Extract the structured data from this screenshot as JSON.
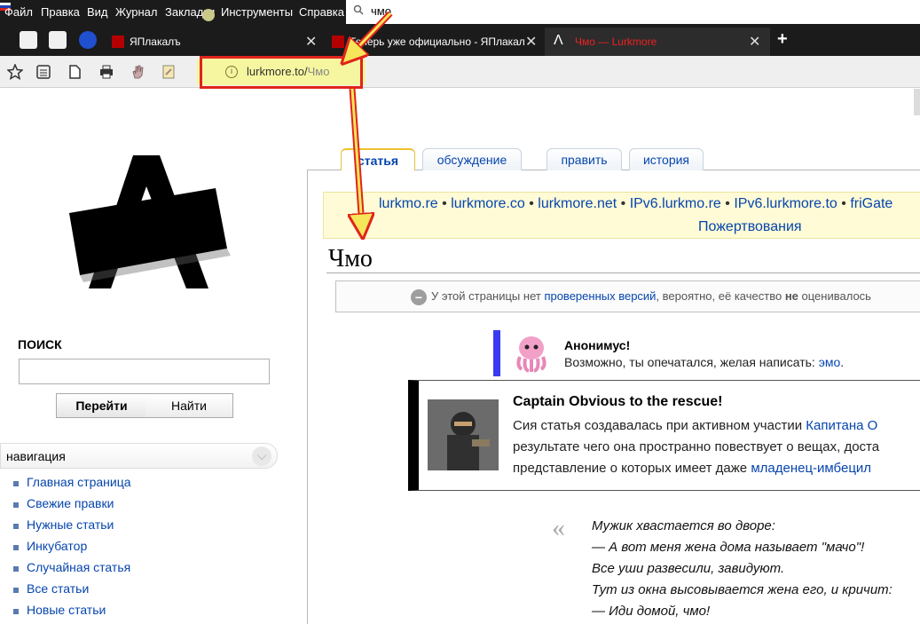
{
  "menubar": {
    "items": [
      "Файл",
      "Правка",
      "Вид",
      "Журнал",
      "Закладки",
      "Инструменты",
      "Справка"
    ],
    "search_text": "чмо"
  },
  "tabs": [
    {
      "title": "ЯПлакалъ"
    },
    {
      "title": "Теперь уже официально - ЯПлакалъ"
    },
    {
      "title": "Чмо — Lurkmore"
    }
  ],
  "toolbar": {
    "url_host": "lurkmore.to/",
    "url_path": "Чмо"
  },
  "sidebar": {
    "search_label": "ПОИСК",
    "go_label": "Перейти",
    "find_label": "Найти",
    "nav_heading": "навигация",
    "nav_items": [
      "Главная страница",
      "Свежие правки",
      "Нужные статьи",
      "Инкубатор",
      "Случайная статья",
      "Все статьи",
      "Новые статьи"
    ]
  },
  "content_tabs": {
    "article": "статья",
    "discussion": "обсуждение",
    "edit": "править",
    "history": "история"
  },
  "mirrors": {
    "items": [
      "lurkmo.re",
      "lurkmore.co",
      "lurkmore.net",
      "IPv6.lurkmo.re",
      "IPv6.lurkmore.to",
      "friGate"
    ],
    "donations": "Пожертвования"
  },
  "page_title": "Чмо",
  "flagged_notice": {
    "text_before": "У этой страницы нет ",
    "link": "проверенных версий",
    "text_mid": ", вероятно, её качество ",
    "bold": "не",
    "text_after": " оценивалось"
  },
  "anon_box": {
    "title": "Анонимус!",
    "text": "Возможно, ты опечатался, желая написать: ",
    "link": "эмо",
    "end": "."
  },
  "captain_box": {
    "title": "Captain Obvious to the rescue!",
    "line1_text": "Сия статья создавалась при активном участии ",
    "line1_link": "Капитана О",
    "line2": "результате чего она пространно повествует о вещах, доста",
    "line3_text": "представление о которых имеет даже ",
    "line3_link": "младенец-имбецил"
  },
  "quote_lines": [
    "Мужик хвастается во дворе:",
    "— А вот меня жена дома называет \"мачо\"!",
    "Все уши развесили, завидуют.",
    "Тут из окна высовывается жена его, и кричит:",
    "— Иди домой, чмо!"
  ],
  "colors": {
    "chrome_dark": "#1b1b1b",
    "link": "#0645ad",
    "highlight_red": "#e0241b",
    "arrow_yellow": "#f5e65a"
  }
}
